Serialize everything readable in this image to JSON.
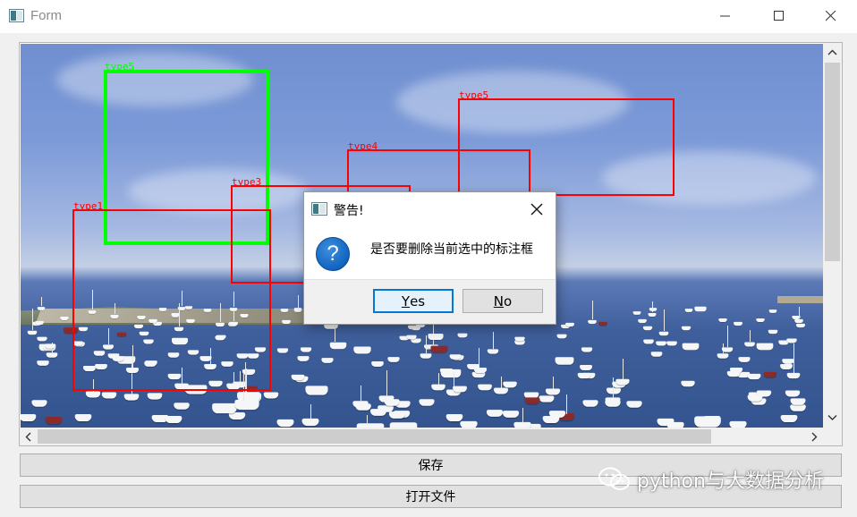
{
  "window": {
    "title": "Form",
    "icon": "app-window-icon",
    "controls": [
      "minimize-icon",
      "maximize-icon",
      "close-icon"
    ]
  },
  "viewer": {
    "annotations": [
      {
        "label": "type5",
        "selected": true,
        "color": "#00ff00"
      },
      {
        "label": "type5",
        "selected": false,
        "color": "#ff0000"
      },
      {
        "label": "type4",
        "selected": false,
        "color": "#ff0000"
      },
      {
        "label": "type3",
        "selected": false,
        "color": "#ff0000"
      },
      {
        "label": "type1",
        "selected": false,
        "color": "#ff0000"
      }
    ]
  },
  "buttons": {
    "save_label": "保存",
    "open_label": "打开文件"
  },
  "dialog": {
    "title": "警告!",
    "icon": "question-icon",
    "message": "是否要删除当前选中的标注框",
    "yes_label": "Yes",
    "yes_mnemonic": "Y",
    "yes_rest": "es",
    "no_label": "No",
    "no_mnemonic": "N",
    "no_rest": "o"
  },
  "watermark": {
    "text": "python与大数据分析"
  },
  "colors": {
    "selected_box": "#00ff00",
    "box": "#ff0000",
    "default_button_border": "#0078d7"
  }
}
